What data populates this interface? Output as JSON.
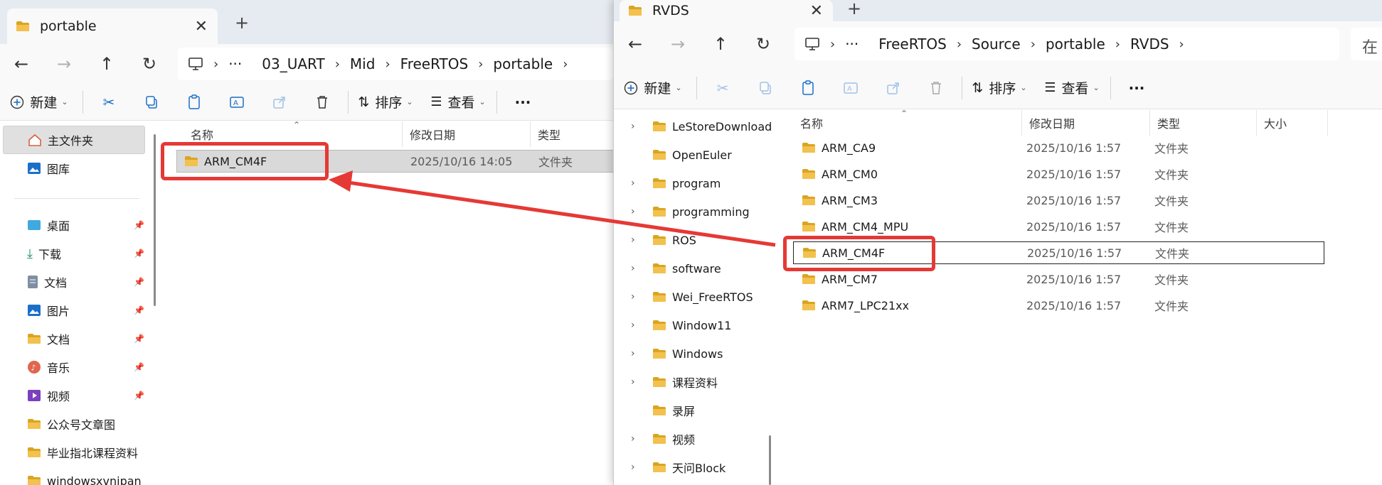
{
  "colors": {
    "accent": "#e53935",
    "folder": "#f2c14e",
    "folder_dark": "#d9a521",
    "titlebar": "#e6eaf1",
    "toolbar_bg": "#f9f9f9"
  },
  "left": {
    "tab_title": "portable",
    "breadcrumb": [
      "03_UART",
      "Mid",
      "FreeRTOS",
      "portable"
    ],
    "toolbar": {
      "new_label": "新建",
      "sort_label": "排序",
      "view_label": "查看"
    },
    "columns": {
      "name": "名称",
      "date": "修改日期",
      "type": "类型"
    },
    "rows": [
      {
        "name": "ARM_CM4F",
        "date": "2025/10/16 14:05",
        "type": "文件夹"
      }
    ],
    "nav": {
      "home": "主文件夹",
      "gallery": "图库",
      "desktop": "桌面",
      "downloads": "下载",
      "documents": "文档",
      "pictures": "图片",
      "documents2": "文档",
      "music": "音乐",
      "videos": "视频",
      "folder1": "公众号文章图",
      "folder2": "毕业指北课程资料",
      "folder3": "windowsxvnipan"
    }
  },
  "right": {
    "tab_title": "RVDS",
    "breadcrumb": [
      "FreeRTOS",
      "Source",
      "portable",
      "RVDS"
    ],
    "search_placeholder": "在",
    "toolbar": {
      "new_label": "新建",
      "sort_label": "排序",
      "view_label": "查看"
    },
    "columns": {
      "name": "名称",
      "date": "修改日期",
      "type": "类型",
      "size": "大小"
    },
    "rows": [
      {
        "name": "ARM_CA9",
        "date": "2025/10/16 1:57",
        "type": "文件夹"
      },
      {
        "name": "ARM_CM0",
        "date": "2025/10/16 1:57",
        "type": "文件夹"
      },
      {
        "name": "ARM_CM3",
        "date": "2025/10/16 1:57",
        "type": "文件夹"
      },
      {
        "name": "ARM_CM4_MPU",
        "date": "2025/10/16 1:57",
        "type": "文件夹"
      },
      {
        "name": "ARM_CM4F",
        "date": "2025/10/16 1:57",
        "type": "文件夹"
      },
      {
        "name": "ARM_CM7",
        "date": "2025/10/16 1:57",
        "type": "文件夹"
      },
      {
        "name": "ARM7_LPC21xx",
        "date": "2025/10/16 1:57",
        "type": "文件夹"
      }
    ],
    "nav": [
      {
        "label": "LeStoreDownload",
        "expandable": true
      },
      {
        "label": "OpenEuler",
        "expandable": false
      },
      {
        "label": "program",
        "expandable": true
      },
      {
        "label": "programming",
        "expandable": true
      },
      {
        "label": "ROS",
        "expandable": true
      },
      {
        "label": "software",
        "expandable": true
      },
      {
        "label": "Wei_FreeRTOS",
        "expandable": true
      },
      {
        "label": "Window11",
        "expandable": true
      },
      {
        "label": "Windows",
        "expandable": true
      },
      {
        "label": "课程资料",
        "expandable": true
      },
      {
        "label": "录屏",
        "expandable": false
      },
      {
        "label": "视频",
        "expandable": true
      },
      {
        "label": "天问Block",
        "expandable": true
      }
    ]
  }
}
